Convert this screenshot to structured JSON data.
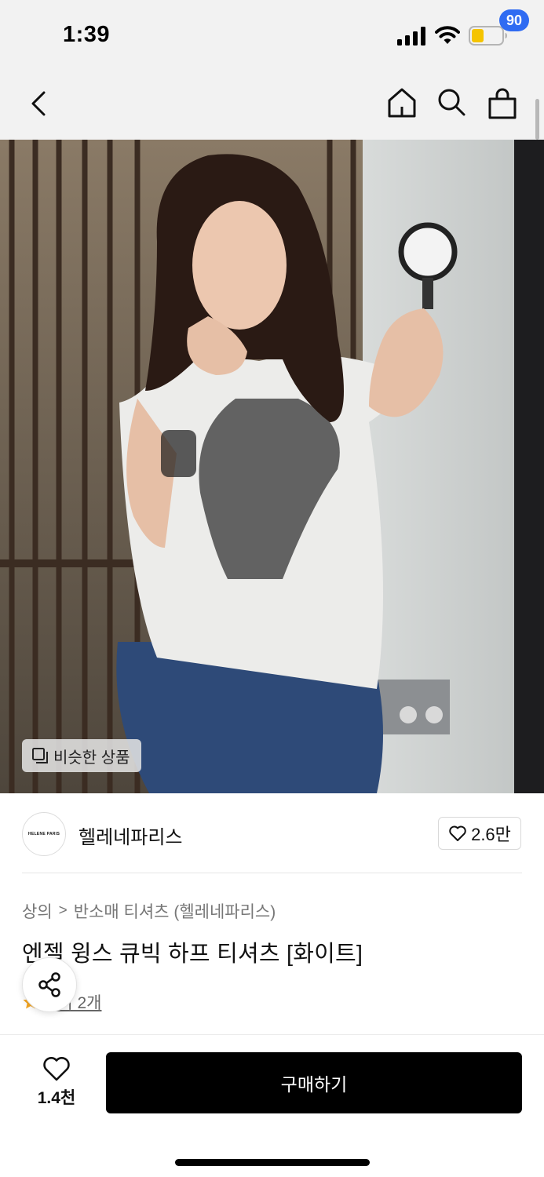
{
  "status_bar": {
    "time": "1:39",
    "icons": [
      "signal-icon",
      "wifi-icon",
      "battery-icon"
    ],
    "battery_color": "#f5c400"
  },
  "nav": {
    "icons": [
      "back-icon",
      "home-icon",
      "search-icon",
      "shopping-bag-icon"
    ],
    "cart_count": "90",
    "badge_color": "#2f6bf2"
  },
  "product_image": {
    "similar_label": "비슷한 상품",
    "similar_icon": "similar-items-icon"
  },
  "brand": {
    "logo_text": "HELENE PARIS",
    "name": "헬레네파리스",
    "like_icon": "heart-outline-icon",
    "like_count": "2.6만"
  },
  "product": {
    "breadcrumb": [
      "상의",
      "반소매 티셔츠 (헬레네파리스)"
    ],
    "breadcrumb_separator": ">",
    "title": "엔젤 윙스 큐빅 하프 티셔츠 [화이트]",
    "review_text": "후기 2개",
    "star_color": "#f5a623",
    "share_icon": "share-icon"
  },
  "bottom_bar": {
    "wish_icon": "heart-outline-icon",
    "wish_count": "1.4천",
    "buy_label": "구매하기",
    "buy_color": "#000000"
  }
}
